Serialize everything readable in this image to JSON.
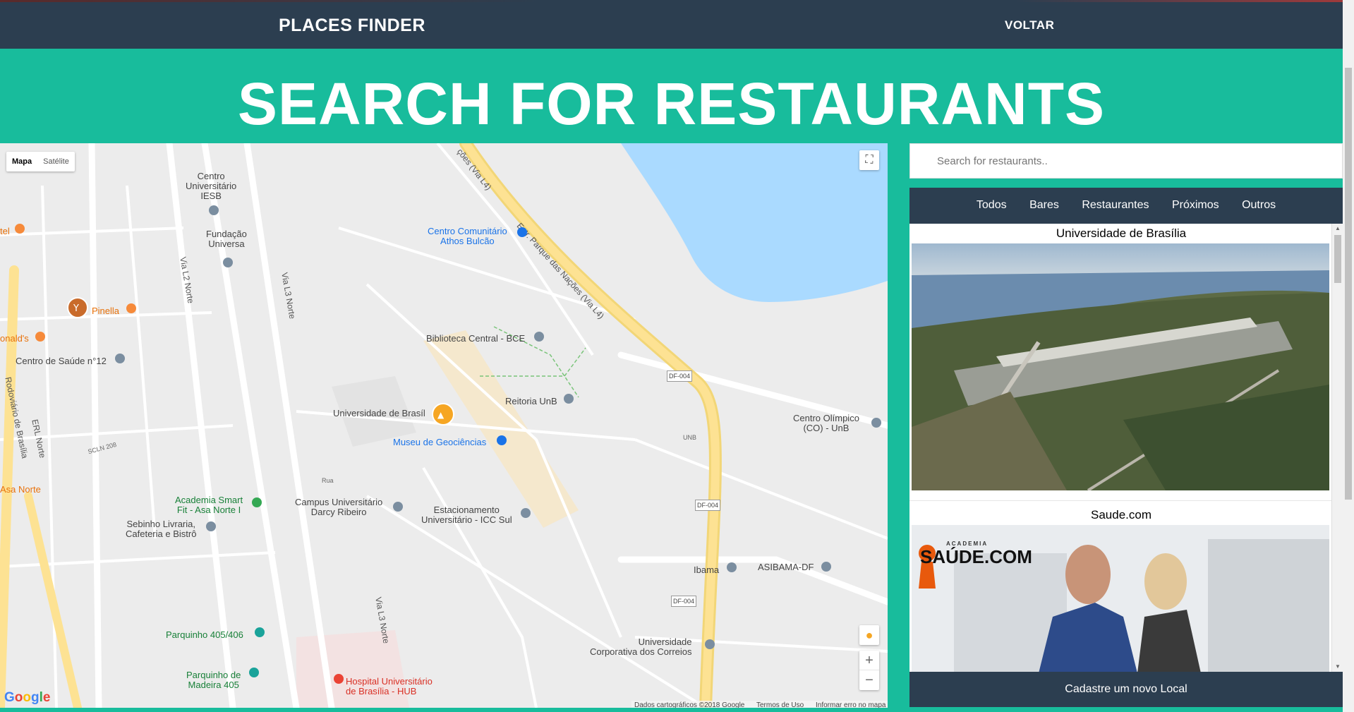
{
  "navbar": {
    "brand": "PLACES FINDER",
    "back_label": "VOLTAR"
  },
  "hero": {
    "title": "SEARCH FOR RESTAURANTS"
  },
  "map": {
    "type_buttons": [
      "Mapa",
      "Satélite"
    ],
    "labels": {
      "centro_universitario": "Centro\nUniversitário\nIESB",
      "fundacao": "Fundação\nUniversa",
      "centro_comunitario": "Centro Comunitário\nAthos Bulcão",
      "biblioteca": "Biblioteca Central - BCE",
      "reitoria": "Reitoria UnB",
      "unb": "Universidade de Brasíl",
      "museu": "Museu de Geociências",
      "pinella": "Pinella",
      "mcdonalds": "onald's",
      "saude": "Centro de Saúde n°12",
      "academia": "Academia Smart\nFit - Asa Norte I",
      "sebinho": "Sebinho Livraria,\nCafeteria e Bistrô",
      "campus": "Campus Universitário\nDarcy Ribeiro",
      "estacionamento": "Estacionamento\nUniversitário - ICC Sul",
      "centro_olimpico": "Centro Olímpico\n(CO) - UnB",
      "ibama": "Ibama",
      "asibama": "ASIBAMA-DF",
      "correios": "Universidade\nCorporativa dos Correios",
      "parquinho1": "Parquinho 405/406",
      "parquinho2": "Parquinho de\nMadeira 405",
      "hospital": "Hospital Universitário\nde Brasília - HUB",
      "asa_norte": "Asa Norte",
      "hotel": "tel",
      "road_l4": "Estr. Parque das Nações (Via L4)",
      "road_l4_top": "ções (Via L4)",
      "road_l2": "Via L2 Norte",
      "road_l3": "Via L3 Norte",
      "road_l3b": "Via L3 Norte",
      "road_erl": "ERL Norte",
      "road_rodoviario": "Rodoviário de Brasília",
      "df004_1": "DF-004",
      "df004_2": "DF-004",
      "df004_3": "DF-004",
      "scln": "SCLN 208",
      "unb_label": "UNB",
      "rua": "Rua"
    },
    "google_logo": "Google",
    "attribution": [
      "Dados cartográficos ©2018 Google",
      "Termos de Uso",
      "Informar erro no mapa"
    ],
    "zoom_in": "+",
    "zoom_out": "−"
  },
  "search": {
    "placeholder": "Search for restaurants.."
  },
  "filters": [
    "Todos",
    "Bares",
    "Restaurantes",
    "Próximos",
    "Outros"
  ],
  "places": [
    {
      "name": "Universidade de Brasília"
    },
    {
      "name": "Saude.com",
      "logo_top": "ACADEMIA",
      "logo_main": "SAÚDE.COM"
    }
  ],
  "register_label": "Cadastre um novo Local",
  "colors": {
    "navbar": "#2c3e50",
    "accent": "#18bc9c"
  }
}
